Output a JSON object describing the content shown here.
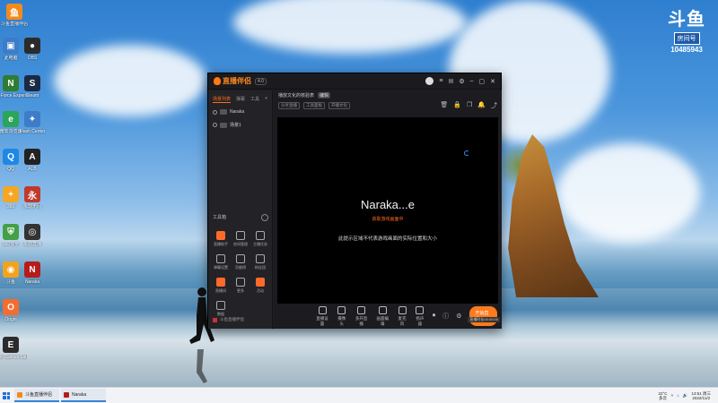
{
  "desktop": {
    "icons": [
      {
        "label": "斗鱼直播伴侣",
        "color": "#f28a1e",
        "glyph": "鱼"
      },
      {
        "label": "此电脑",
        "color": "#3d7cc9",
        "glyph": "▣"
      },
      {
        "label": "OBS",
        "color": "#2b2b2b",
        "glyph": "●"
      },
      {
        "label": "GeForce Experience",
        "color": "#2e7d32",
        "glyph": "N"
      },
      {
        "label": "Steam",
        "color": "#1b2a44",
        "glyph": "S"
      },
      {
        "label": "微软浏览器",
        "color": "#2aa55a",
        "glyph": "e"
      },
      {
        "label": "Flash Center",
        "color": "#3d7cc9",
        "glyph": "✦"
      },
      {
        "label": "QQ",
        "color": "#1e88e5",
        "glyph": "Q"
      },
      {
        "label": "ALB",
        "color": "#222",
        "glyph": "A"
      },
      {
        "label": "360",
        "color": "#f5a623",
        "glyph": "+"
      },
      {
        "label": "永劫无间",
        "color": "#c0392b",
        "glyph": "永"
      },
      {
        "label": "360安全",
        "color": "#43a047",
        "glyph": "⛨"
      },
      {
        "label": "永劫直播",
        "color": "#333",
        "glyph": "◎"
      },
      {
        "label": "斗鱼",
        "color": "#f2a31e",
        "glyph": "◉"
      },
      {
        "label": "Naraka",
        "color": "#b71c1c",
        "glyph": "N"
      },
      {
        "label": "Origin",
        "color": "#f56c2d",
        "glyph": "O"
      },
      {
        "label": "Epic Games Launcher",
        "color": "#2b2b2b",
        "glyph": "E"
      }
    ]
  },
  "watermark": {
    "logo": "斗鱼",
    "badge": "房间号",
    "room": "10485943"
  },
  "app": {
    "name": "直播伴侣",
    "version": "4.0",
    "sidebar": {
      "tabs": [
        "场景列表",
        "弹幕",
        "工具"
      ],
      "scenes": [
        "Naraka",
        "场景1"
      ],
      "tools_title": "工具箱",
      "tools": [
        {
          "label": "直播助手",
          "accent": true
        },
        {
          "label": "房间管理",
          "accent": false
        },
        {
          "label": "主播任务",
          "accent": false
        },
        {
          "label": "弹幕设置",
          "accent": false
        },
        {
          "label": "贡献榜",
          "accent": false
        },
        {
          "label": "粉丝团",
          "accent": false
        },
        {
          "label": "直播间",
          "accent": true
        },
        {
          "label": "更多",
          "accent": false
        },
        {
          "label": "活动",
          "accent": true
        },
        {
          "label": "数据",
          "accent": false
        }
      ],
      "footer": "斗鱼直播伴侣"
    },
    "main": {
      "title": "播放文化的核验表",
      "title_tag": "编辑",
      "sub_chips": [
        "分享直播",
        "工具面板",
        "开播文化"
      ],
      "preview": {
        "title": "Naraka...e",
        "status": "获取游戏画面中",
        "note": "此提示区域不代表游戏画面的实际位置和大小"
      },
      "bottom_items": [
        "直播设置",
        "摄像头",
        "多开直播",
        "画面编辑",
        "麦克风",
        "扬声器"
      ],
      "live_button": "开始直播",
      "live_duration": "直播时长00:00:00"
    }
  },
  "taskbar": {
    "apps": [
      {
        "label": "斗鱼直播伴侣",
        "color": "#f28a1e"
      },
      {
        "label": "Naraka",
        "color": "#b71c1c"
      }
    ],
    "weather": {
      "temp": "22°C",
      "desc": "多云"
    },
    "clock": {
      "time": "13:51 周三",
      "date": "2022/11/2"
    }
  }
}
